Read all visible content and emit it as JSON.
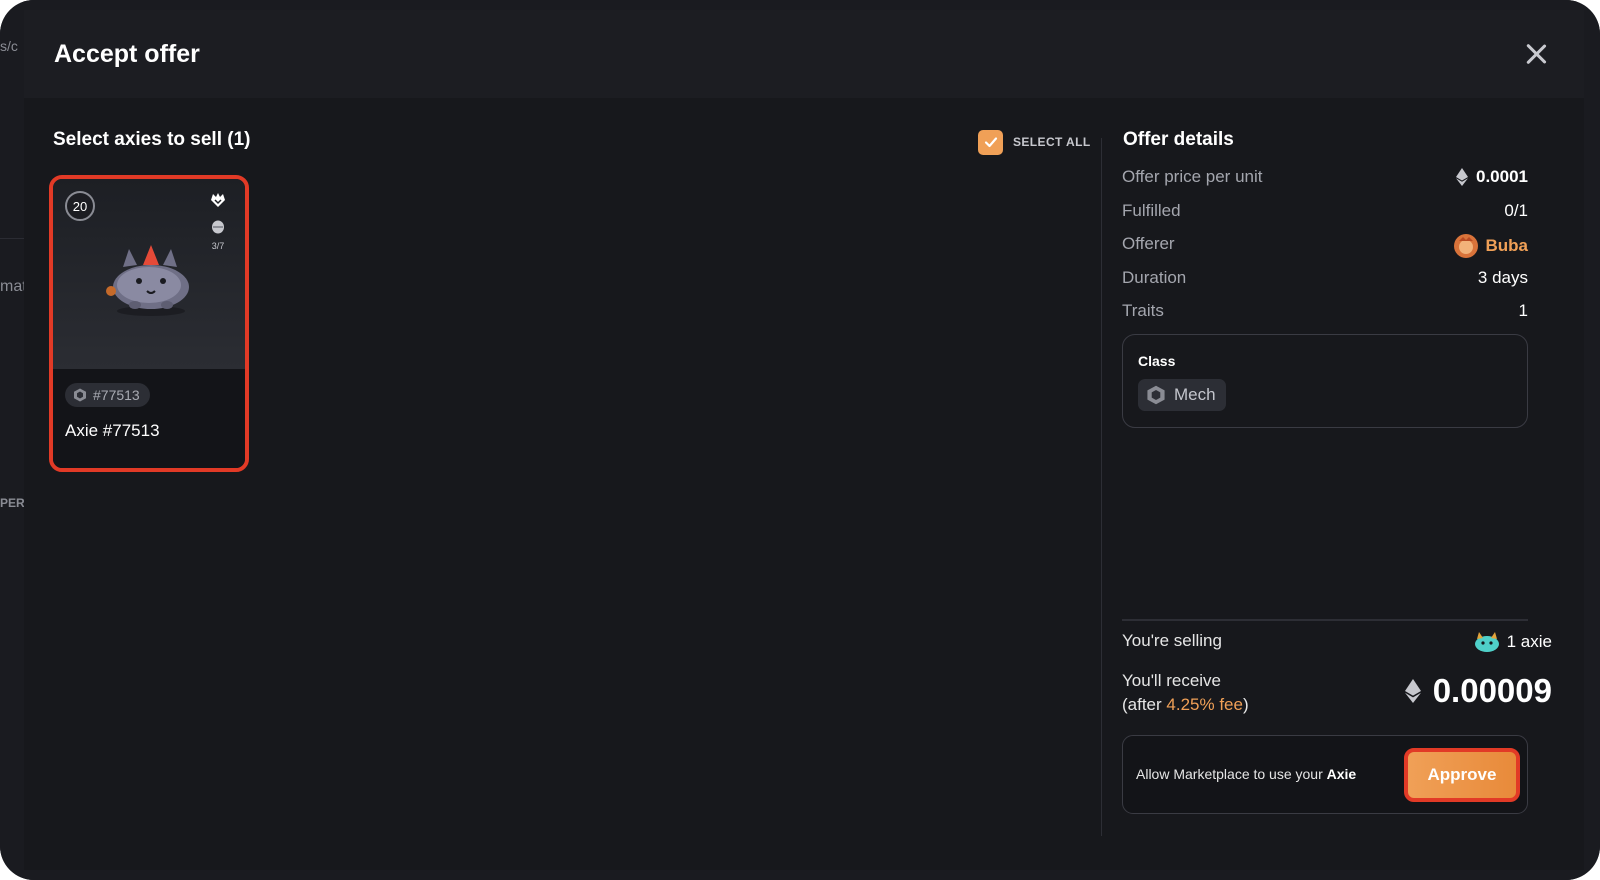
{
  "modal": {
    "title": "Accept offer"
  },
  "selection": {
    "title": "Select axies to sell (1)",
    "select_all_label": "SELECT ALL",
    "select_all_checked": true
  },
  "axie": {
    "level": "20",
    "breed_count": "3/7",
    "id_chip": "#77513",
    "name": "Axie #77513",
    "class": "Mech"
  },
  "offer": {
    "title": "Offer details",
    "rows": [
      {
        "label": "Offer price per unit",
        "value": "0.0001"
      },
      {
        "label": "Fulfilled",
        "value": "0/1"
      },
      {
        "label": "Offerer",
        "value": "Buba"
      },
      {
        "label": "Duration",
        "value": "3 days"
      },
      {
        "label": "Traits",
        "value": "1"
      }
    ],
    "traits": {
      "title": "Class",
      "value": "Mech"
    }
  },
  "summary": {
    "selling_label": "You're selling",
    "selling_value": "1 axie",
    "receive_label": "You'll receive",
    "fee_prefix": "(after ",
    "fee_text": "4.25% fee",
    "fee_suffix": ")",
    "receive_amount": "0.00009"
  },
  "approval": {
    "text_prefix": "Allow Marketplace to use your ",
    "text_bold": "Axie",
    "button_label": "Approve"
  },
  "background": {
    "fragments": [
      "s/c",
      "mat",
      "PER"
    ]
  },
  "colors": {
    "accent": "#f0a057",
    "highlight_border": "#e23a26",
    "modal_bg": "#17181c"
  }
}
